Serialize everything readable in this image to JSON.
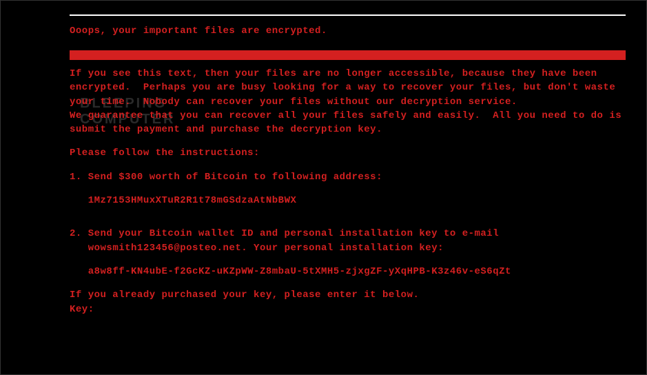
{
  "watermark": {
    "line1": "BLEEPING",
    "line2": "COMPUTER"
  },
  "header": "Ooops, your important files are encrypted.",
  "body": {
    "p1a": "If you see this text, then your files are no longer accessible, because they have been encrypted.  Perhaps you are busy looking for a way to recover your files, but don't waste your time.  Nobody can recover your files without our decryption service.",
    "p1b": "We guarantee that you can recover all your files safely and easily.  All you need to do is submit the payment and purchase the decryption key.",
    "follow": "Please follow the instructions:",
    "step1": "1. Send $300 worth of Bitcoin to following address:",
    "btc_address": "   1Mz7153HMuxXTuR2R1t78mGSdzaAtNbBWX",
    "step2a": "2. Send your Bitcoin wallet ID and personal installation key to e-mail",
    "step2b": "   wowsmith123456@posteo.net. Your personal installation key:",
    "install_key": "   a8w8ff-KN4ubE-f2GcKZ-uKZpWW-Z8mbaU-5tXMH5-zjxgZF-yXqHPB-K3z46v-eS6qZt",
    "already": "If you already purchased your key, please enter it below.",
    "key_prompt": "Key:"
  }
}
